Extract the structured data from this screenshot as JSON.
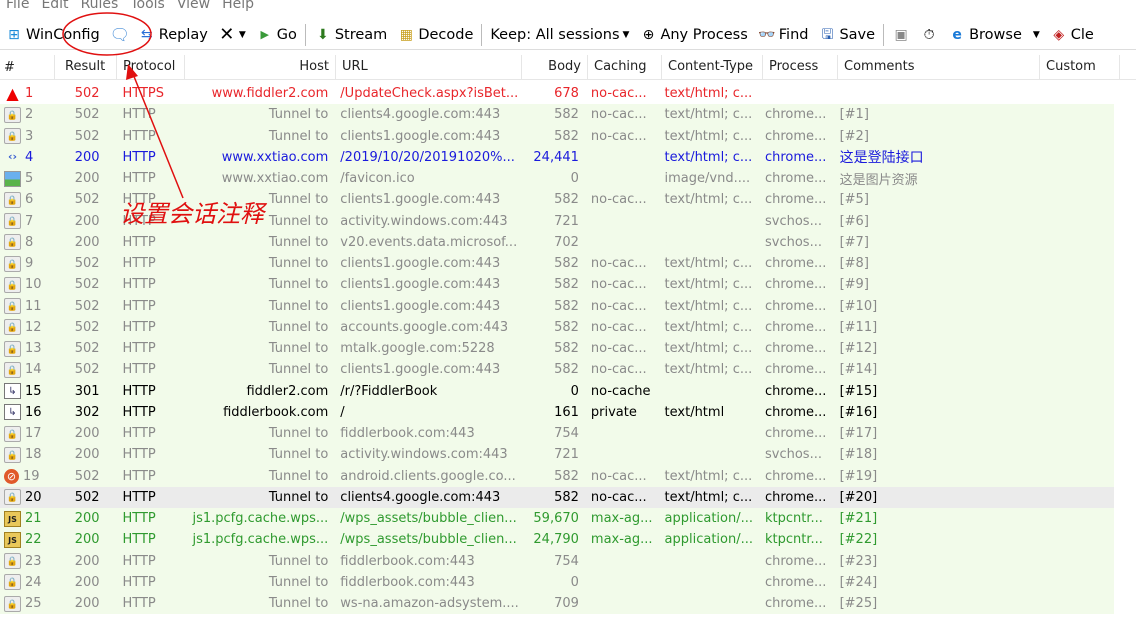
{
  "menu": [
    "File",
    "Edit",
    "Rules",
    "Tools",
    "View",
    "Help"
  ],
  "toolbar": {
    "winconfig": "WinConfig",
    "comment_icon": "speech-bubble-icon",
    "replay": "Replay",
    "remove_icon": "x-icon",
    "go": "Go",
    "stream": "Stream",
    "decode": "Decode",
    "keep": "Keep: All sessions",
    "any_process": "Any Process",
    "find": "Find",
    "save": "Save",
    "browse": "Browse",
    "clear": "Cle"
  },
  "columns": [
    "#",
    "Result",
    "Protocol",
    "Host",
    "URL",
    "Body",
    "Caching",
    "Content-Type",
    "Process",
    "Comments",
    "Custom"
  ],
  "rows": [
    {
      "num": "1",
      "result": "502",
      "protocol": "HTTPS",
      "host": "www.fiddler2.com",
      "url": "/UpdateCheck.aspx?isBet...",
      "body": "678",
      "caching": "no-cac...",
      "ctype": "text/html; c...",
      "process": "",
      "comments": "",
      "style": "error",
      "icon": "warning"
    },
    {
      "num": "2",
      "result": "502",
      "protocol": "HTTP",
      "host": "Tunnel to",
      "url": "clients4.google.com:443",
      "body": "582",
      "caching": "no-cac...",
      "ctype": "text/html; c...",
      "process": "chrome...",
      "comments": "[#1]",
      "style": "gray",
      "icon": "lock"
    },
    {
      "num": "3",
      "result": "502",
      "protocol": "HTTP",
      "host": "Tunnel to",
      "url": "clients1.google.com:443",
      "body": "582",
      "caching": "no-cac...",
      "ctype": "text/html; c...",
      "process": "chrome...",
      "comments": "[#2]",
      "style": "gray",
      "icon": "lock"
    },
    {
      "num": "4",
      "result": "200",
      "protocol": "HTTP",
      "host": "www.xxtiao.com",
      "url": "/2019/10/20/20191020%...",
      "body": "24,441",
      "caching": "",
      "ctype": "text/html; c...",
      "process": "chrome...",
      "comments": "这是登陆接口",
      "style": "blue",
      "icon": "html"
    },
    {
      "num": "5",
      "result": "200",
      "protocol": "HTTP",
      "host": "www.xxtiao.com",
      "url": "/favicon.ico",
      "body": "0",
      "caching": "",
      "ctype": "image/vnd....",
      "process": "chrome...",
      "comments": "这是图片资源",
      "style": "gray",
      "icon": "image"
    },
    {
      "num": "6",
      "result": "502",
      "protocol": "HTTP",
      "host": "Tunnel to",
      "url": "clients1.google.com:443",
      "body": "582",
      "caching": "no-cac...",
      "ctype": "text/html; c...",
      "process": "chrome...",
      "comments": "[#5]",
      "style": "gray",
      "icon": "lock"
    },
    {
      "num": "7",
      "result": "200",
      "protocol": "HTTP",
      "host": "Tunnel to",
      "url": "activity.windows.com:443",
      "body": "721",
      "caching": "",
      "ctype": "",
      "process": "svchos...",
      "comments": "[#6]",
      "style": "gray",
      "icon": "lock"
    },
    {
      "num": "8",
      "result": "200",
      "protocol": "HTTP",
      "host": "Tunnel to",
      "url": "v20.events.data.microsof...",
      "body": "702",
      "caching": "",
      "ctype": "",
      "process": "svchos...",
      "comments": "[#7]",
      "style": "gray",
      "icon": "lock"
    },
    {
      "num": "9",
      "result": "502",
      "protocol": "HTTP",
      "host": "Tunnel to",
      "url": "clients1.google.com:443",
      "body": "582",
      "caching": "no-cac...",
      "ctype": "text/html; c...",
      "process": "chrome...",
      "comments": "[#8]",
      "style": "gray",
      "icon": "lock"
    },
    {
      "num": "10",
      "result": "502",
      "protocol": "HTTP",
      "host": "Tunnel to",
      "url": "clients1.google.com:443",
      "body": "582",
      "caching": "no-cac...",
      "ctype": "text/html; c...",
      "process": "chrome...",
      "comments": "[#9]",
      "style": "gray",
      "icon": "lock"
    },
    {
      "num": "11",
      "result": "502",
      "protocol": "HTTP",
      "host": "Tunnel to",
      "url": "clients1.google.com:443",
      "body": "582",
      "caching": "no-cac...",
      "ctype": "text/html; c...",
      "process": "chrome...",
      "comments": "[#10]",
      "style": "gray",
      "icon": "lock"
    },
    {
      "num": "12",
      "result": "502",
      "protocol": "HTTP",
      "host": "Tunnel to",
      "url": "accounts.google.com:443",
      "body": "582",
      "caching": "no-cac...",
      "ctype": "text/html; c...",
      "process": "chrome...",
      "comments": "[#11]",
      "style": "gray",
      "icon": "lock"
    },
    {
      "num": "13",
      "result": "502",
      "protocol": "HTTP",
      "host": "Tunnel to",
      "url": "mtalk.google.com:5228",
      "body": "582",
      "caching": "no-cac...",
      "ctype": "text/html; c...",
      "process": "chrome...",
      "comments": "[#12]",
      "style": "gray",
      "icon": "lock"
    },
    {
      "num": "14",
      "result": "502",
      "protocol": "HTTP",
      "host": "Tunnel to",
      "url": "clients1.google.com:443",
      "body": "582",
      "caching": "no-cac...",
      "ctype": "text/html; c...",
      "process": "chrome...",
      "comments": "[#14]",
      "style": "gray",
      "icon": "lock"
    },
    {
      "num": "15",
      "result": "301",
      "protocol": "HTTP",
      "host": "fiddler2.com",
      "url": "/r/?FiddlerBook",
      "body": "0",
      "caching": "no-cache",
      "ctype": "",
      "process": "chrome...",
      "comments": "[#15]",
      "style": "black",
      "icon": "redirect"
    },
    {
      "num": "16",
      "result": "302",
      "protocol": "HTTP",
      "host": "fiddlerbook.com",
      "url": "/",
      "body": "161",
      "caching": "private",
      "ctype": "text/html",
      "process": "chrome...",
      "comments": "[#16]",
      "style": "black",
      "icon": "redirect"
    },
    {
      "num": "17",
      "result": "200",
      "protocol": "HTTP",
      "host": "Tunnel to",
      "url": "fiddlerbook.com:443",
      "body": "754",
      "caching": "",
      "ctype": "",
      "process": "chrome...",
      "comments": "[#17]",
      "style": "gray",
      "icon": "lock"
    },
    {
      "num": "18",
      "result": "200",
      "protocol": "HTTP",
      "host": "Tunnel to",
      "url": "activity.windows.com:443",
      "body": "721",
      "caching": "",
      "ctype": "",
      "process": "svchos...",
      "comments": "[#18]",
      "style": "gray",
      "icon": "lock"
    },
    {
      "num": "19",
      "result": "502",
      "protocol": "HTTP",
      "host": "Tunnel to",
      "url": "android.clients.google.co...",
      "body": "582",
      "caching": "no-cac...",
      "ctype": "text/html; c...",
      "process": "chrome...",
      "comments": "[#19]",
      "style": "gray",
      "icon": "blocked"
    },
    {
      "num": "20",
      "result": "502",
      "protocol": "HTTP",
      "host": "Tunnel to",
      "url": "clients4.google.com:443",
      "body": "582",
      "caching": "no-cac...",
      "ctype": "text/html; c...",
      "process": "chrome...",
      "comments": "[#20]",
      "style": "black",
      "icon": "lock",
      "selected": true
    },
    {
      "num": "21",
      "result": "200",
      "protocol": "HTTP",
      "host": "js1.pcfg.cache.wps...",
      "url": "/wps_assets/bubble_clien...",
      "body": "59,670",
      "caching": "max-ag...",
      "ctype": "application/...",
      "process": "ktpcntr...",
      "comments": "[#21]",
      "style": "green",
      "icon": "js"
    },
    {
      "num": "22",
      "result": "200",
      "protocol": "HTTP",
      "host": "js1.pcfg.cache.wps...",
      "url": "/wps_assets/bubble_clien...",
      "body": "24,790",
      "caching": "max-ag...",
      "ctype": "application/...",
      "process": "ktpcntr...",
      "comments": "[#22]",
      "style": "green",
      "icon": "js"
    },
    {
      "num": "23",
      "result": "200",
      "protocol": "HTTP",
      "host": "Tunnel to",
      "url": "fiddlerbook.com:443",
      "body": "754",
      "caching": "",
      "ctype": "",
      "process": "chrome...",
      "comments": "[#23]",
      "style": "gray",
      "icon": "lock"
    },
    {
      "num": "24",
      "result": "200",
      "protocol": "HTTP",
      "host": "Tunnel to",
      "url": "fiddlerbook.com:443",
      "body": "0",
      "caching": "",
      "ctype": "",
      "process": "chrome...",
      "comments": "[#24]",
      "style": "gray",
      "icon": "lock"
    },
    {
      "num": "25",
      "result": "200",
      "protocol": "HTTP",
      "host": "Tunnel to",
      "url": "ws-na.amazon-adsystem....",
      "body": "709",
      "caching": "",
      "ctype": "",
      "process": "chrome...",
      "comments": "[#25]",
      "style": "gray",
      "icon": "lock"
    }
  ],
  "annotation": {
    "text": "设置会话注释",
    "color": "#e01010"
  }
}
